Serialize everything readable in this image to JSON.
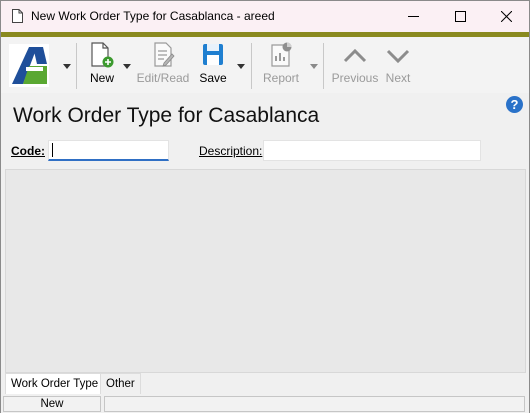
{
  "window": {
    "title": "New Work Order Type for Casablanca - areed"
  },
  "toolbar": {
    "new_label": "New",
    "edit_read_label": "Edit/Read",
    "save_label": "Save",
    "report_label": "Report",
    "previous_label": "Previous",
    "next_label": "Next"
  },
  "header": {
    "title": "Work Order Type for Casablanca",
    "help_icon": "?"
  },
  "form": {
    "code_label": "Code:",
    "code_value": "",
    "description_label": "Description:",
    "description_value": ""
  },
  "tabs": [
    {
      "label": "Work Order Type",
      "active": true
    },
    {
      "label": "Other",
      "active": false
    }
  ],
  "status": {
    "mode": "New",
    "info": ""
  },
  "colors": {
    "toolbar_accent": "#8a8a1f",
    "logo_blue": "#1f4f9a",
    "logo_green": "#5aa832",
    "save_blue": "#1f7fd0",
    "focus_underline": "#2f6fc4",
    "help_blue": "#2a72c9"
  }
}
